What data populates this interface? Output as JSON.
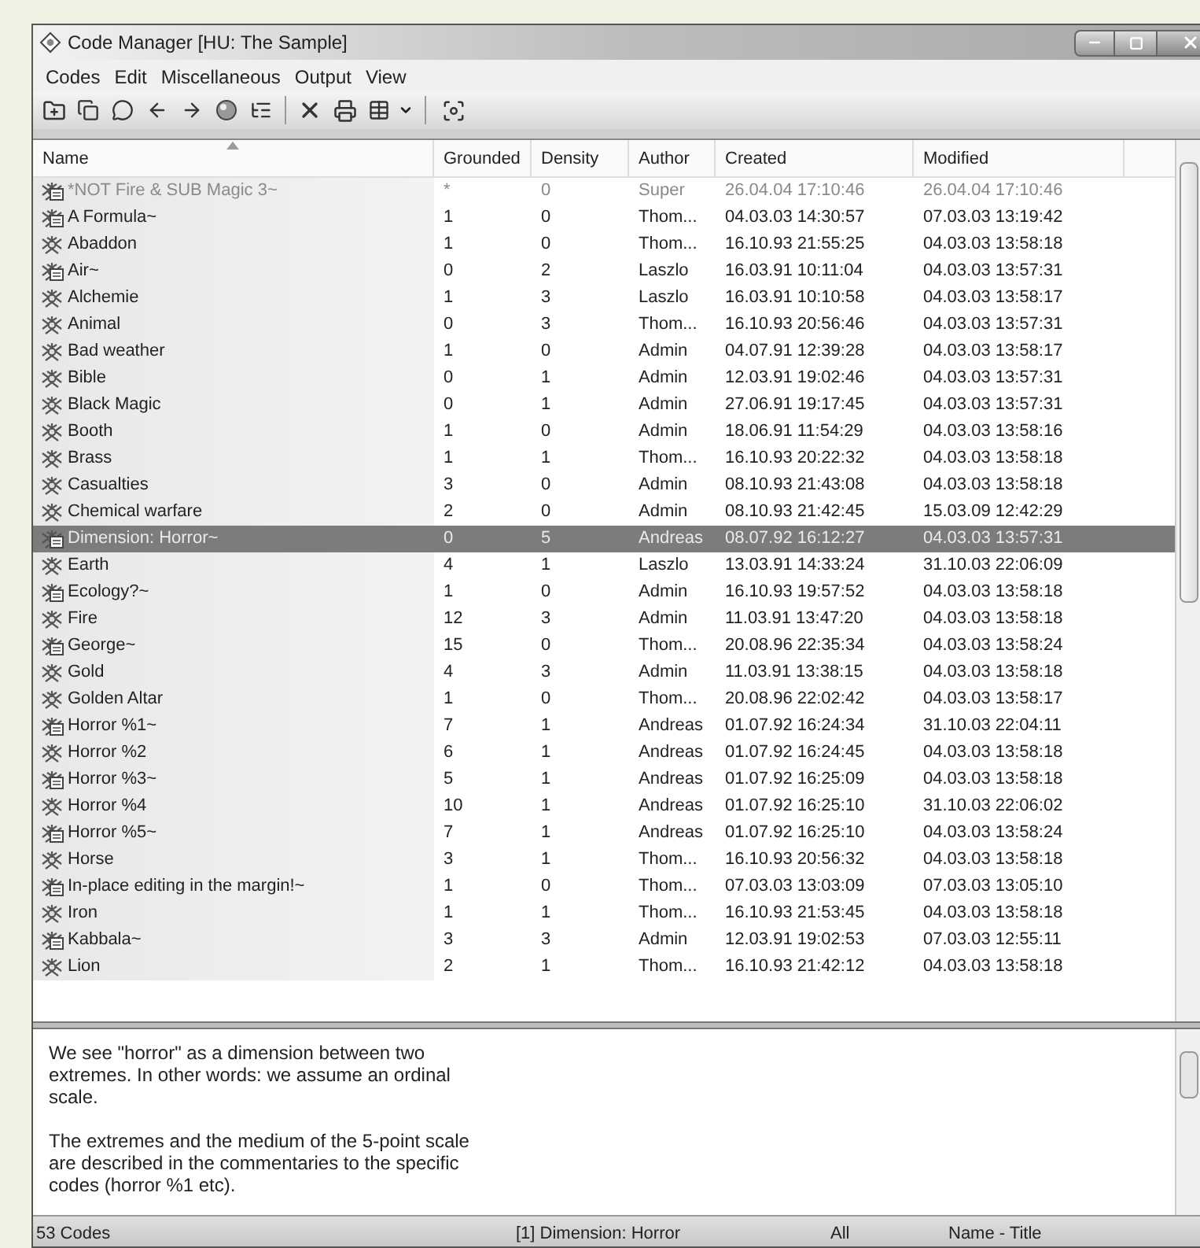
{
  "window": {
    "title": "Code Manager [HU: The Sample]"
  },
  "menu": [
    "Codes",
    "Edit",
    "Miscellaneous",
    "Output",
    "View"
  ],
  "table": {
    "columns": [
      {
        "label": "Name",
        "sorted": true
      },
      {
        "label": "Grounded",
        "sorted": false
      },
      {
        "label": "Density",
        "sorted": false
      },
      {
        "label": "Author",
        "sorted": false
      },
      {
        "label": "Created",
        "sorted": false
      },
      {
        "label": "Modified",
        "sorted": false
      }
    ],
    "rows": [
      {
        "kind": "memo",
        "dimmed": true,
        "selected": false,
        "cells": [
          "*NOT Fire & SUB Magic 3~",
          "*",
          "0",
          "Super",
          "26.04.04 17:10:46",
          "26.04.04 17:10:46"
        ]
      },
      {
        "kind": "memo",
        "dimmed": false,
        "selected": false,
        "cells": [
          "A Formula~",
          "1",
          "0",
          "Thom...",
          "04.03.03 14:30:57",
          "07.03.03 13:19:42"
        ]
      },
      {
        "kind": "plain",
        "dimmed": false,
        "selected": false,
        "cells": [
          "Abaddon",
          "1",
          "0",
          "Thom...",
          "16.10.93 21:55:25",
          "04.03.03 13:58:18"
        ]
      },
      {
        "kind": "memo",
        "dimmed": false,
        "selected": false,
        "cells": [
          "Air~",
          "0",
          "2",
          "Laszlo",
          "16.03.91 10:11:04",
          "04.03.03 13:57:31"
        ]
      },
      {
        "kind": "plain",
        "dimmed": false,
        "selected": false,
        "cells": [
          "Alchemie",
          "1",
          "3",
          "Laszlo",
          "16.03.91 10:10:58",
          "04.03.03 13:58:17"
        ]
      },
      {
        "kind": "plain",
        "dimmed": false,
        "selected": false,
        "cells": [
          "Animal",
          "0",
          "3",
          "Thom...",
          "16.10.93 20:56:46",
          "04.03.03 13:57:31"
        ]
      },
      {
        "kind": "plain",
        "dimmed": false,
        "selected": false,
        "cells": [
          "Bad weather",
          "1",
          "0",
          "Admin",
          "04.07.91 12:39:28",
          "04.03.03 13:58:17"
        ]
      },
      {
        "kind": "plain",
        "dimmed": false,
        "selected": false,
        "cells": [
          "Bible",
          "0",
          "1",
          "Admin",
          "12.03.91 19:02:46",
          "04.03.03 13:57:31"
        ]
      },
      {
        "kind": "plain",
        "dimmed": false,
        "selected": false,
        "cells": [
          "Black Magic",
          "0",
          "1",
          "Admin",
          "27.06.91 19:17:45",
          "04.03.03 13:57:31"
        ]
      },
      {
        "kind": "plain",
        "dimmed": false,
        "selected": false,
        "cells": [
          "Booth",
          "1",
          "0",
          "Admin",
          "18.06.91 11:54:29",
          "04.03.03 13:58:16"
        ]
      },
      {
        "kind": "plain",
        "dimmed": false,
        "selected": false,
        "cells": [
          "Brass",
          "1",
          "1",
          "Thom...",
          "16.10.93 20:22:32",
          "04.03.03 13:58:18"
        ]
      },
      {
        "kind": "plain",
        "dimmed": false,
        "selected": false,
        "cells": [
          "Casualties",
          "3",
          "0",
          "Admin",
          "08.10.93 21:43:08",
          "04.03.03 13:58:18"
        ]
      },
      {
        "kind": "plain",
        "dimmed": false,
        "selected": false,
        "cells": [
          "Chemical warfare",
          "2",
          "0",
          "Admin",
          "08.10.93 21:42:45",
          "15.03.09 12:42:29"
        ]
      },
      {
        "kind": "memo",
        "dimmed": false,
        "selected": true,
        "cells": [
          "Dimension: Horror~",
          "0",
          "5",
          "Andreas",
          "08.07.92 16:12:27",
          "04.03.03 13:57:31"
        ]
      },
      {
        "kind": "plain",
        "dimmed": false,
        "selected": false,
        "cells": [
          "Earth",
          "4",
          "1",
          "Laszlo",
          "13.03.91 14:33:24",
          "31.10.03 22:06:09"
        ]
      },
      {
        "kind": "memo",
        "dimmed": false,
        "selected": false,
        "cells": [
          "Ecology?~",
          "1",
          "0",
          "Admin",
          "16.10.93 19:57:52",
          "04.03.03 13:58:18"
        ]
      },
      {
        "kind": "plain",
        "dimmed": false,
        "selected": false,
        "cells": [
          "Fire",
          "12",
          "3",
          "Admin",
          "11.03.91 13:47:20",
          "04.03.03 13:58:18"
        ]
      },
      {
        "kind": "memo",
        "dimmed": false,
        "selected": false,
        "cells": [
          "George~",
          "15",
          "0",
          "Thom...",
          "20.08.96 22:35:34",
          "04.03.03 13:58:24"
        ]
      },
      {
        "kind": "plain",
        "dimmed": false,
        "selected": false,
        "cells": [
          "Gold",
          "4",
          "3",
          "Admin",
          "11.03.91 13:38:15",
          "04.03.03 13:58:18"
        ]
      },
      {
        "kind": "plain",
        "dimmed": false,
        "selected": false,
        "cells": [
          "Golden Altar",
          "1",
          "0",
          "Thom...",
          "20.08.96 22:02:42",
          "04.03.03 13:58:17"
        ]
      },
      {
        "kind": "memo",
        "dimmed": false,
        "selected": false,
        "cells": [
          "Horror %1~",
          "7",
          "1",
          "Andreas",
          "01.07.92 16:24:34",
          "31.10.03 22:04:11"
        ]
      },
      {
        "kind": "plain",
        "dimmed": false,
        "selected": false,
        "cells": [
          "Horror %2",
          "6",
          "1",
          "Andreas",
          "01.07.92 16:24:45",
          "04.03.03 13:58:18"
        ]
      },
      {
        "kind": "memo",
        "dimmed": false,
        "selected": false,
        "cells": [
          "Horror %3~",
          "5",
          "1",
          "Andreas",
          "01.07.92 16:25:09",
          "04.03.03 13:58:18"
        ]
      },
      {
        "kind": "plain",
        "dimmed": false,
        "selected": false,
        "cells": [
          "Horror %4",
          "10",
          "1",
          "Andreas",
          "01.07.92 16:25:10",
          "31.10.03 22:06:02"
        ]
      },
      {
        "kind": "memo",
        "dimmed": false,
        "selected": false,
        "cells": [
          "Horror %5~",
          "7",
          "1",
          "Andreas",
          "01.07.92 16:25:10",
          "04.03.03 13:58:24"
        ]
      },
      {
        "kind": "plain",
        "dimmed": false,
        "selected": false,
        "cells": [
          "Horse",
          "3",
          "1",
          "Thom...",
          "16.10.93 20:56:32",
          "04.03.03 13:58:18"
        ]
      },
      {
        "kind": "memo",
        "dimmed": false,
        "selected": false,
        "cells": [
          "In-place editing in the margin!~",
          "1",
          "0",
          "Thom...",
          "07.03.03 13:03:09",
          "07.03.03 13:05:10"
        ]
      },
      {
        "kind": "plain",
        "dimmed": false,
        "selected": false,
        "cells": [
          "Iron",
          "1",
          "1",
          "Thom...",
          "16.10.93 21:53:45",
          "04.03.03 13:58:18"
        ]
      },
      {
        "kind": "memo",
        "dimmed": false,
        "selected": false,
        "cells": [
          "Kabbala~",
          "3",
          "3",
          "Admin",
          "12.03.91 19:02:53",
          "07.03.03 12:55:11"
        ]
      },
      {
        "kind": "plain",
        "dimmed": false,
        "selected": false,
        "cells": [
          "Lion",
          "2",
          "1",
          "Thom...",
          "16.10.93 21:42:12",
          "04.03.03 13:58:18"
        ]
      }
    ]
  },
  "comment": {
    "paragraphs": [
      "We see \"horror\" as a dimension between two extremes. In other words: we assume an ordinal scale.",
      "The extremes and the medium of the 5-point scale are described in the commentaries to the specific codes (horror %1 etc)."
    ]
  },
  "status_bar": [
    "53 Codes",
    "[1] Dimension: Horror",
    "All",
    "Name - Title"
  ]
}
